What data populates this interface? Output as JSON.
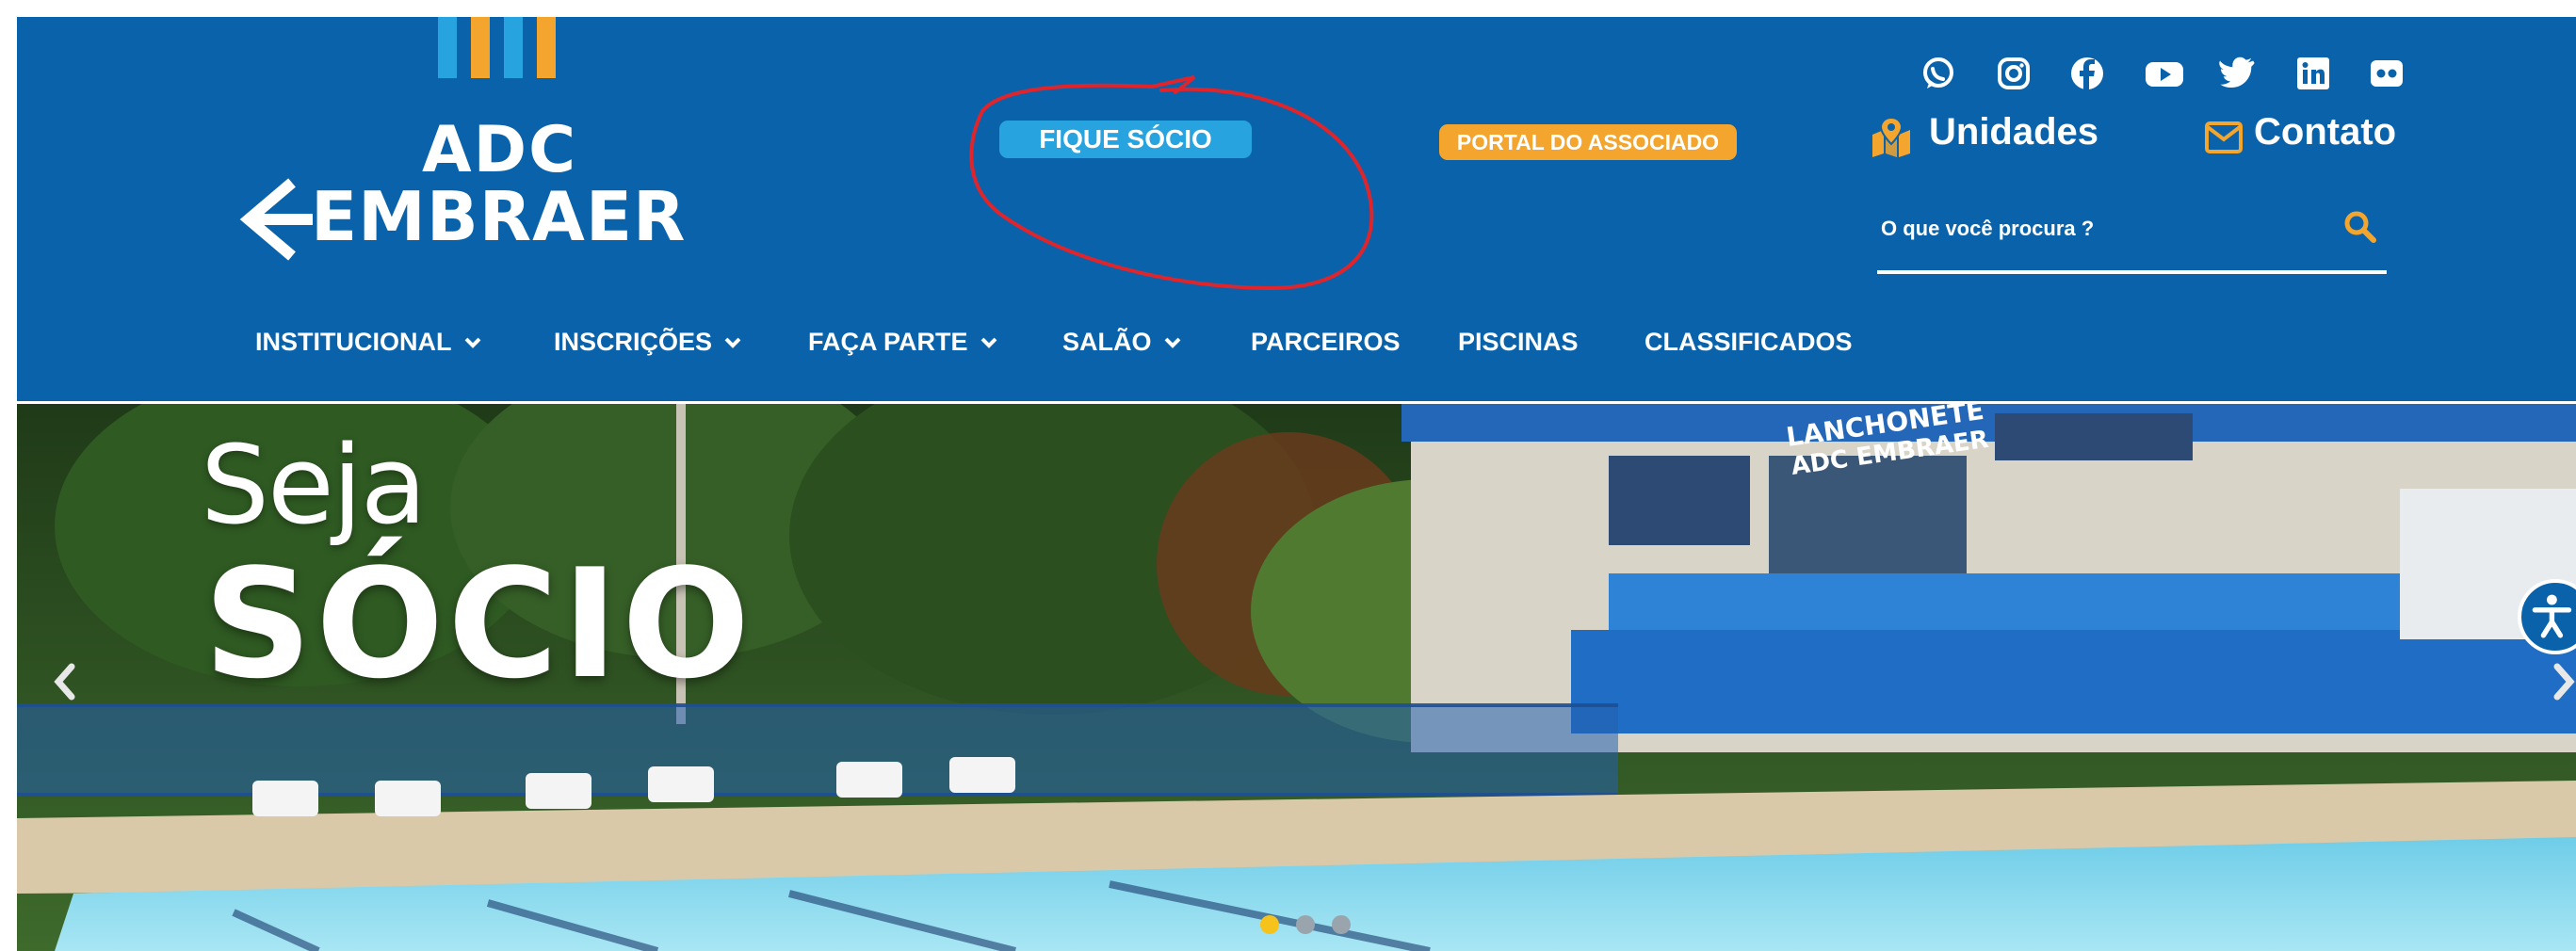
{
  "header": {
    "logo": {
      "line1": "ADC",
      "line2": "EMBRAER",
      "bar_colors": [
        "#27a3e0",
        "#f3a52e",
        "#27a3e0",
        "#f3a52e"
      ]
    },
    "fique_socio_label": "FIQUE SÓCIO",
    "portal_label": "PORTAL DO ASSOCIADO",
    "social_icons": [
      "whatsapp-icon",
      "instagram-icon",
      "facebook-icon",
      "youtube-icon",
      "twitter-icon",
      "linkedin-icon",
      "flickr-icon"
    ],
    "unidades_label": "Unidades",
    "contato_label": "Contato",
    "search": {
      "placeholder": "O que você procura ?"
    }
  },
  "menu": {
    "items": [
      {
        "label": "INSTITUCIONAL",
        "dropdown": true
      },
      {
        "label": "INSCRIÇÕES",
        "dropdown": true
      },
      {
        "label": "FAÇA PARTE",
        "dropdown": true
      },
      {
        "label": "SALÃO",
        "dropdown": true
      },
      {
        "label": "PARCEIROS",
        "dropdown": false
      },
      {
        "label": "PISCINAS",
        "dropdown": false
      },
      {
        "label": "CLASSIFICADOS",
        "dropdown": false
      }
    ]
  },
  "hero": {
    "headline_small": "Seja",
    "headline_big": "SÓCIO",
    "building_sign": [
      "LANCHONETE",
      "ADC EMBRAER"
    ],
    "slide_count": 3,
    "active_slide": 1
  },
  "colors": {
    "brand_blue": "#0a63aa",
    "accent_orange": "#f3a52e",
    "accent_light_blue": "#27a3e0",
    "annotation_red": "#e0242c"
  }
}
